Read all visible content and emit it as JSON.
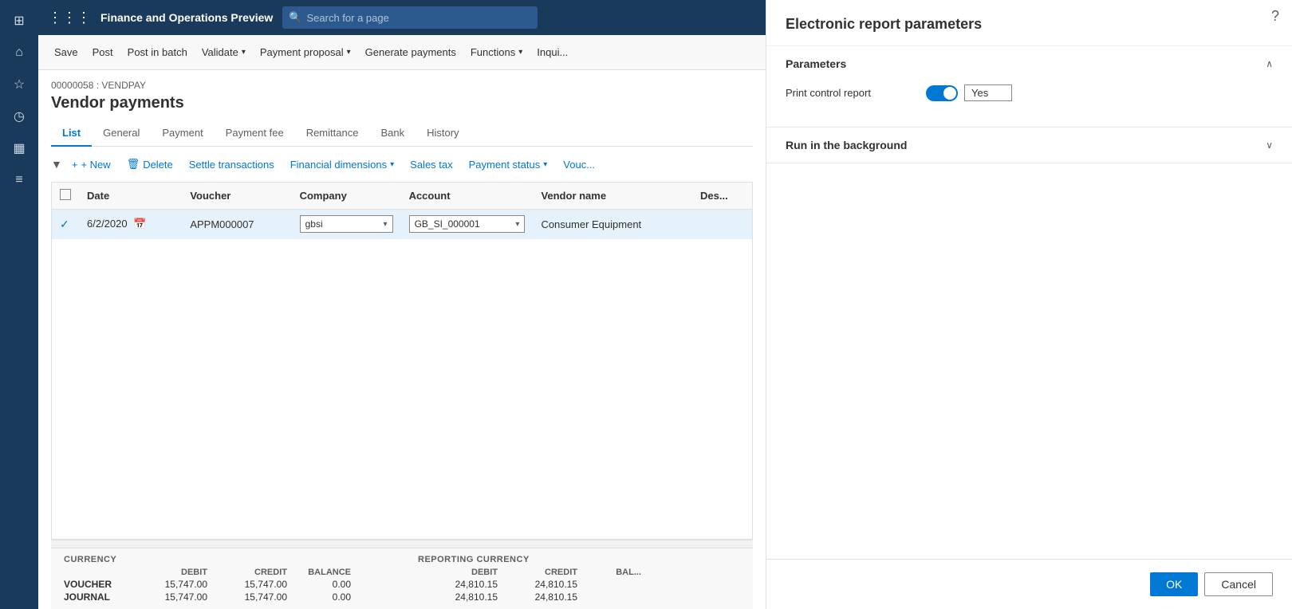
{
  "app": {
    "title": "Finance and Operations Preview",
    "search_placeholder": "Search for a page"
  },
  "toolbar": {
    "save_label": "Save",
    "post_label": "Post",
    "post_in_batch_label": "Post in batch",
    "validate_label": "Validate",
    "payment_proposal_label": "Payment proposal",
    "generate_payments_label": "Generate payments",
    "functions_label": "Functions",
    "inquire_label": "Inqui..."
  },
  "page": {
    "breadcrumb": "00000058 : VENDPAY",
    "title": "Vendor payments"
  },
  "tabs": [
    {
      "label": "List",
      "active": true
    },
    {
      "label": "General",
      "active": false
    },
    {
      "label": "Payment",
      "active": false
    },
    {
      "label": "Payment fee",
      "active": false
    },
    {
      "label": "Remittance",
      "active": false
    },
    {
      "label": "Bank",
      "active": false
    },
    {
      "label": "History",
      "active": false
    }
  ],
  "actions": {
    "new_label": "+ New",
    "delete_label": "Delete",
    "settle_transactions_label": "Settle transactions",
    "financial_dimensions_label": "Financial dimensions",
    "sales_tax_label": "Sales tax",
    "payment_status_label": "Payment status",
    "voucher_label": "Vouc..."
  },
  "table": {
    "columns": [
      "",
      "Date",
      "Voucher",
      "Company",
      "Account",
      "Vendor name",
      "Des..."
    ],
    "rows": [
      {
        "selected": true,
        "date": "6/2/2020",
        "voucher": "APPM000007",
        "company": "gbsi",
        "account": "GB_SI_000001",
        "vendor_name": "Consumer Equipment",
        "description": ""
      }
    ]
  },
  "footer": {
    "currency_label": "CURRENCY",
    "reporting_currency_label": "REPORTING CURRENCY",
    "debit_label": "DEBIT",
    "credit_label": "CREDIT",
    "balance_label": "BALANCE",
    "bal_label": "BAL...",
    "rows": [
      {
        "label": "VOUCHER",
        "debit": "15,747.00",
        "credit": "15,747.00",
        "balance": "0.00",
        "r_debit": "24,810.15",
        "r_credit": "24,810.15"
      },
      {
        "label": "JOURNAL",
        "debit": "15,747.00",
        "credit": "15,747.00",
        "balance": "0.00",
        "r_debit": "24,810.15",
        "r_credit": "24,810.15"
      }
    ]
  },
  "right_panel": {
    "title": "Electronic report parameters",
    "parameters_section": {
      "title": "Parameters",
      "expanded": true,
      "fields": [
        {
          "label": "Print control report",
          "toggle_value": true,
          "text_value": "Yes"
        }
      ]
    },
    "run_in_background_section": {
      "title": "Run in the background",
      "expanded": false
    },
    "ok_label": "OK",
    "cancel_label": "Cancel"
  },
  "sidebar": {
    "icons": [
      {
        "name": "grid-icon",
        "symbol": "⊞"
      },
      {
        "name": "home-icon",
        "symbol": "⌂"
      },
      {
        "name": "star-icon",
        "symbol": "☆"
      },
      {
        "name": "clock-icon",
        "symbol": "○"
      },
      {
        "name": "table-icon",
        "symbol": "▦"
      },
      {
        "name": "list-icon",
        "symbol": "≡"
      }
    ]
  }
}
